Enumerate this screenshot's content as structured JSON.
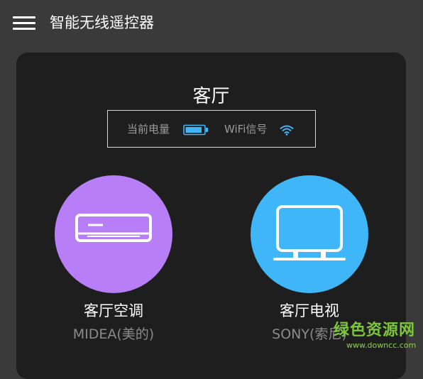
{
  "app_bar": {
    "title": "智能无线遥控器",
    "menu_icon": "hamburger-menu-icon"
  },
  "room": {
    "name": "客厅",
    "battery_label": "当前电量",
    "battery_icon": "battery-icon",
    "battery_level": 0.9,
    "wifi_label": "WiFi信号",
    "wifi_icon": "wifi-icon"
  },
  "devices": [
    {
      "name": "客厅空调",
      "brand": "MIDEA(美的)",
      "icon": "air-conditioner-icon",
      "color": "#b77ef7"
    },
    {
      "name": "客厅电视",
      "brand": "SONY(索尼)",
      "icon": "tv-icon",
      "color": "#3fb6f7"
    }
  ],
  "watermark": {
    "text": "绿色资源网",
    "url": "www.downcc.com"
  },
  "colors": {
    "background": "#3a3a3a",
    "card": "#1e1e1e",
    "accent": "#3fb6f7"
  }
}
